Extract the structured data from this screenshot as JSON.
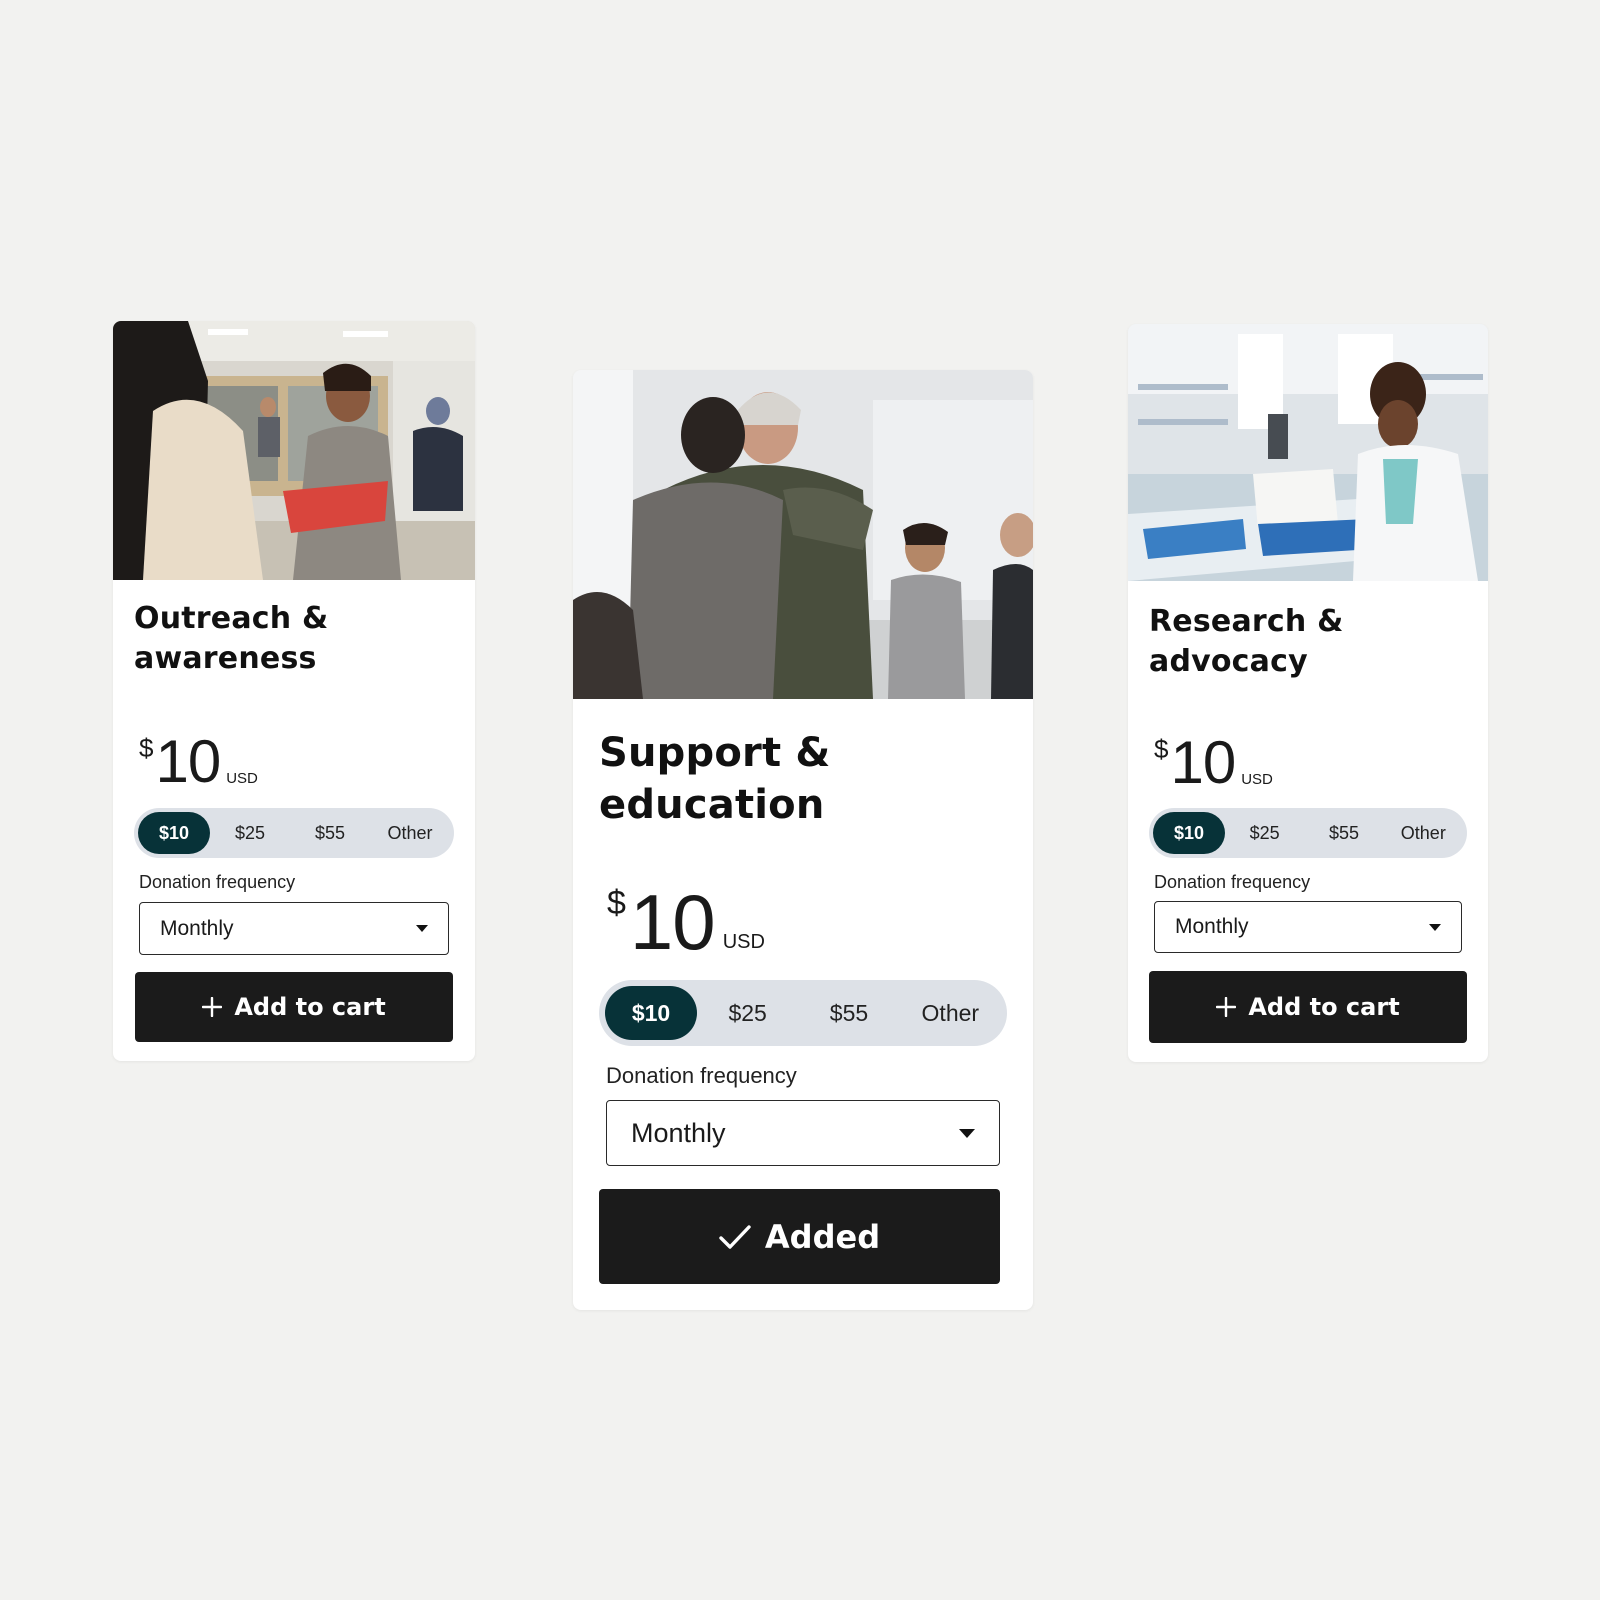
{
  "cards": [
    {
      "title_line1": "Outreach &",
      "title_line2": "awareness",
      "currency_symbol": "$",
      "amount": "10",
      "currency": "USD",
      "options": [
        "$10",
        "$25",
        "$55",
        "Other"
      ],
      "selected_option": "$10",
      "frequency_label": "Donation frequency",
      "frequency_value": "Monthly",
      "button_icon": "plus-icon",
      "button_label": "Add to cart"
    },
    {
      "title_line1": "Support &",
      "title_line2": "education",
      "currency_symbol": "$",
      "amount": "10",
      "currency": "USD",
      "options": [
        "$10",
        "$25",
        "$55",
        "Other"
      ],
      "selected_option": "$10",
      "frequency_label": "Donation frequency",
      "frequency_value": "Monthly",
      "button_icon": "checkmark-icon",
      "button_label": "Added"
    },
    {
      "title_line1": "Research &",
      "title_line2": "advocacy",
      "currency_symbol": "$",
      "amount": "10",
      "currency": "USD",
      "options": [
        "$10",
        "$25",
        "$55",
        "Other"
      ],
      "selected_option": "$10",
      "frequency_label": "Donation frequency",
      "frequency_value": "Monthly",
      "button_icon": "plus-icon",
      "button_label": "Add to cart"
    }
  ],
  "colors": {
    "background": "#f2f2f0",
    "selected_pill": "#073238",
    "segment_track": "#dde1e7",
    "button": "#1b1b1b"
  }
}
